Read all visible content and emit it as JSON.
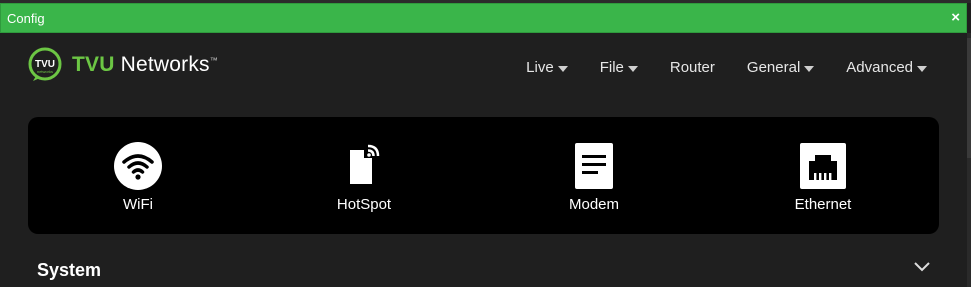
{
  "window": {
    "title": "Config",
    "close_label": "×"
  },
  "brand": {
    "name_prefix": "TVU",
    "name_rest": " Networks",
    "mark": "™",
    "logo_icon": "tvu-logo-icon"
  },
  "nav": {
    "items": [
      {
        "label": "Live",
        "has_dropdown": true
      },
      {
        "label": "File",
        "has_dropdown": true
      },
      {
        "label": "Router",
        "has_dropdown": false
      },
      {
        "label": "General",
        "has_dropdown": true
      },
      {
        "label": "Advanced",
        "has_dropdown": true
      }
    ]
  },
  "connections": [
    {
      "label": "WiFi",
      "icon": "wifi-icon"
    },
    {
      "label": "HotSpot",
      "icon": "hotspot-icon"
    },
    {
      "label": "Modem",
      "icon": "modem-icon"
    },
    {
      "label": "Ethernet",
      "icon": "ethernet-icon"
    }
  ],
  "section": {
    "title": "System",
    "icon": "chevron-down-icon"
  },
  "colors": {
    "titlebar": "#3ab54a",
    "brand_green": "#6cc644",
    "panel": "#000000",
    "background": "#1f1f1f"
  }
}
